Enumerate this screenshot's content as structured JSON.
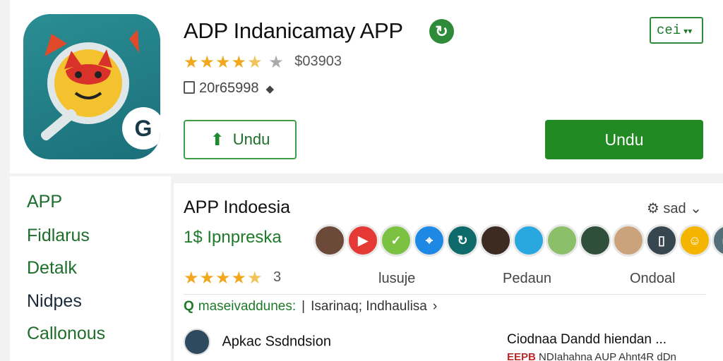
{
  "header": {
    "app_title": "ADP Indanicamay APP",
    "language_select": "cei",
    "rating_count": "$03903",
    "size_text": "20r65998",
    "outline_button": "Undu",
    "primary_button": "Undu"
  },
  "sidebar": {
    "items": [
      {
        "label": "APP"
      },
      {
        "label": "Fidlarus"
      },
      {
        "label": "Detalk"
      },
      {
        "label": "Nidpes"
      },
      {
        "label": "Callonous"
      }
    ]
  },
  "main": {
    "section_title": "APP Indoesia",
    "sort_label": "sad",
    "subtitle": "1$ Ipnpreska",
    "rating_num": "3",
    "columns": [
      "lusuje",
      "Pedaun",
      "Ondoal"
    ],
    "meta_left": "maseivaddunes:",
    "meta_right": "Isarinaq; Indhaulisa",
    "developer_name": "Apkac Ssdndsion",
    "right_title": "Ciodnaa Dandd hiendan ...",
    "right_sub_red": "EEPB",
    "right_sub": "NDIahahna AUP Ahnt4R dDn"
  },
  "avatars": [
    {
      "name": "avatar-person-1",
      "color": "#6b4a3a"
    },
    {
      "name": "youtube-icon",
      "color": "#e53935"
    },
    {
      "name": "chat-icon",
      "color": "#7cc242"
    },
    {
      "name": "compass-icon",
      "color": "#1e88e5"
    },
    {
      "name": "sync-icon",
      "color": "#0f6b6b"
    },
    {
      "name": "avatar-person-2",
      "color": "#3d2b22"
    },
    {
      "name": "avatar-person-3",
      "color": "#29a8e0"
    },
    {
      "name": "avatar-person-4",
      "color": "#8bbf6a"
    },
    {
      "name": "avatar-person-5",
      "color": "#2f4f3a"
    },
    {
      "name": "avatar-person-6",
      "color": "#caa27c"
    },
    {
      "name": "phone-icon",
      "color": "#37474f"
    },
    {
      "name": "emoji-icon",
      "color": "#f4b400"
    },
    {
      "name": "device-icon",
      "color": "#546e7a"
    },
    {
      "name": "avatar-person-7",
      "color": "#d6b08a"
    }
  ],
  "colors": {
    "accent": "#218a22",
    "star": "#f2a81d",
    "brand_icon": "#1b6f7a"
  }
}
